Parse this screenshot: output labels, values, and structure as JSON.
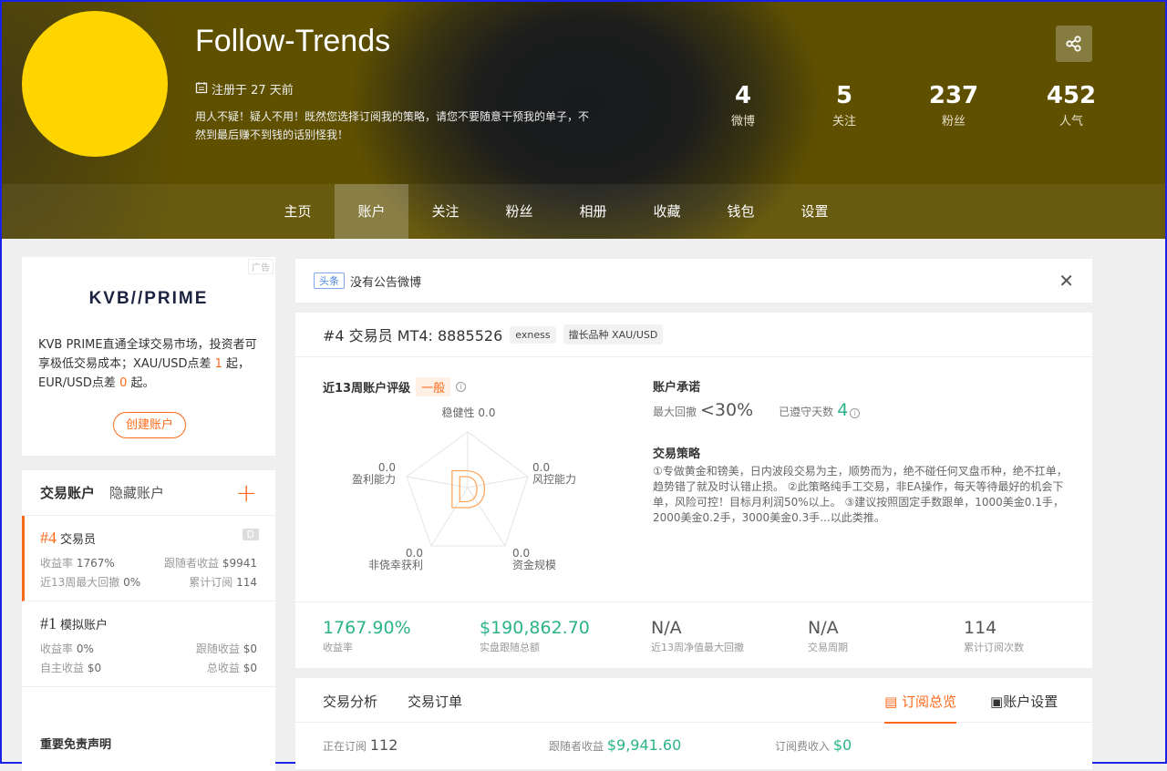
{
  "profile": {
    "name": "Follow-Trends",
    "registered": "注册于 27 天前",
    "bio": "用人不疑！疑人不用！既然您选择订阅我的策略，请您不要随意干预我的单子，不然到最后赚不到钱的话别怪我！"
  },
  "stats": [
    {
      "value": "4",
      "label": "微博"
    },
    {
      "value": "5",
      "label": "关注"
    },
    {
      "value": "237",
      "label": "粉丝"
    },
    {
      "value": "452",
      "label": "人气"
    }
  ],
  "nav": [
    "主页",
    "账户",
    "关注",
    "粉丝",
    "相册",
    "收藏",
    "钱包",
    "设置"
  ],
  "ad": {
    "tag": "广告",
    "brand": "KVB//PRIME",
    "text_a": "KVB PRIME直通全球交易市场，投资者可享极低交易成本；XAU/USD点差 ",
    "num1": "1",
    "text_b": " 起，EUR/USD点差 ",
    "num2": "0",
    "text_c": " 起。",
    "button": "创建账户"
  },
  "accounts": {
    "tab_active": "交易账户",
    "tab_hidden": "隐藏账户",
    "items": [
      {
        "no": "#4",
        "name": "交易员",
        "badge": "D",
        "r1l": "收益率 ",
        "r1lv": "1767%",
        "r1r": "跟随者收益 ",
        "r1rv": "$9941",
        "r2l": "近13周最大回撤 ",
        "r2lv": "0%",
        "r2r": "累计订阅 ",
        "r2rv": "114"
      },
      {
        "no": "#1",
        "name": "模拟账户",
        "r1l": "收益率 ",
        "r1lv": "0%",
        "r1r": "跟随收益 ",
        "r1rv": "$0",
        "r2l": "自主收益 ",
        "r2lv": "$0",
        "r2r": "总收益 ",
        "r2rv": "$0"
      }
    ],
    "disclaimer": "重要免责声明"
  },
  "notice": {
    "tag": "头条",
    "text": "没有公告微博"
  },
  "account": {
    "title": "#4 交易员 MT4: 8885526",
    "broker": "exness",
    "symbol": "擅长品种 XAU/USD",
    "rating_label": "近13周账户评级",
    "rating_level": "一般",
    "grade": "D",
    "radar": [
      {
        "label": "稳健性",
        "value": "0.0"
      },
      {
        "label": "风控能力",
        "value": "0.0"
      },
      {
        "label": "资金规模",
        "value": "0.0"
      },
      {
        "label": "非侥幸获利",
        "value": "0.0"
      },
      {
        "label": "盈利能力",
        "value": "0.0"
      }
    ],
    "promise_title": "账户承诺",
    "max_dd_label": "最大回撤",
    "max_dd": "<30%",
    "days_label": "已遵守天数",
    "days": "4",
    "strategy_title": "交易策略",
    "strategy": "①专做黄金和镑美，日内波段交易为主，顺势而为，绝不碰任何叉盘币种，绝不扛单，趋势错了就及时认错止损。 ②此策略纯手工交易，非EA操作，每天等待最好的机会下单，风险可控！目标月利润50%以上。 ③建议按照固定手数跟单，1000美金0.1手，2000美金0.2手，3000美金0.3手...以此类推。",
    "kpis": [
      {
        "value": "1767.90%",
        "label": "收益率"
      },
      {
        "value": "$190,862.70",
        "label": "实盘跟随总额"
      },
      {
        "value": "N/A",
        "label": "近13周净值最大回撤"
      },
      {
        "value": "N/A",
        "label": "交易周期"
      },
      {
        "value": "114",
        "label": "累计订阅次数"
      }
    ]
  },
  "tabs": {
    "analysis": "交易分析",
    "orders": "交易订单",
    "overview": "订阅总览",
    "settings": "账户设置",
    "subscribing_label": "正在订阅",
    "subscribing": "112",
    "follower_label": "跟随者收益",
    "follower": "$9,941.60",
    "fee_label": "订阅费收入",
    "fee": "$0"
  }
}
